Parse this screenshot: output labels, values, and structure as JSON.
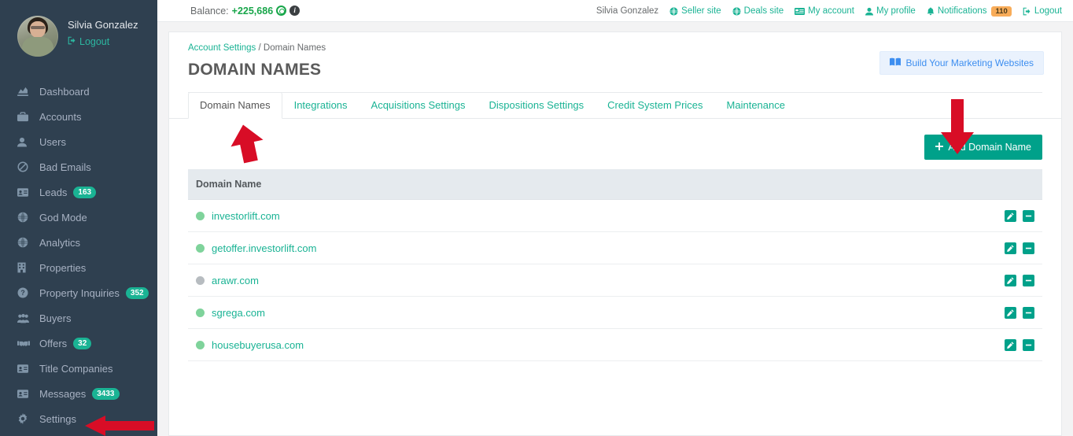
{
  "sidebar": {
    "profile": {
      "name": "Silvia Gonzalez",
      "logout_label": "Logout",
      "avatar_icon": "user-avatar-photo"
    },
    "items": [
      {
        "label": "Dashboard",
        "icon": "chart-area-icon",
        "badge": ""
      },
      {
        "label": "Accounts",
        "icon": "briefcase-icon",
        "badge": ""
      },
      {
        "label": "Users",
        "icon": "user-icon",
        "badge": ""
      },
      {
        "label": "Bad Emails",
        "icon": "ban-icon",
        "badge": ""
      },
      {
        "label": "Leads",
        "icon": "id-card-icon",
        "badge": "163"
      },
      {
        "label": "God Mode",
        "icon": "globe-icon",
        "badge": ""
      },
      {
        "label": "Analytics",
        "icon": "globe-icon",
        "badge": ""
      },
      {
        "label": "Properties",
        "icon": "building-icon",
        "badge": ""
      },
      {
        "label": "Property Inquiries",
        "icon": "question-icon",
        "badge": "352"
      },
      {
        "label": "Buyers",
        "icon": "users-icon",
        "badge": ""
      },
      {
        "label": "Offers",
        "icon": "handshake-icon",
        "badge": "32"
      },
      {
        "label": "Title Companies",
        "icon": "id-card-icon",
        "badge": ""
      },
      {
        "label": "Messages",
        "icon": "id-card-icon",
        "badge": "3433"
      },
      {
        "label": "Settings",
        "icon": "gear-icon",
        "badge": ""
      }
    ]
  },
  "topbar": {
    "balance_label": "Balance:",
    "balance_value": "+225,686",
    "coin_icon": "credit-coin-icon",
    "info_icon": "info-circle-icon",
    "user_name": "Silvia Gonzalez",
    "links": [
      {
        "label": "Seller site",
        "icon": "globe-icon"
      },
      {
        "label": "Deals site",
        "icon": "globe-icon"
      },
      {
        "label": "My account",
        "icon": "card-icon"
      },
      {
        "label": "My profile",
        "icon": "user-icon"
      },
      {
        "label": "Notifications",
        "icon": "bell-icon",
        "badge": "110"
      },
      {
        "label": "Logout",
        "icon": "logout-icon"
      }
    ]
  },
  "breadcrumb": {
    "parent": "Account Settings",
    "separator": "/",
    "current": "Domain Names"
  },
  "page": {
    "title": "DOMAIN NAMES",
    "build_button": "Build Your Marketing Websites",
    "build_icon": "book-icon"
  },
  "tabs": [
    {
      "label": "Domain Names",
      "active": true
    },
    {
      "label": "Integrations",
      "active": false
    },
    {
      "label": "Acquisitions Settings",
      "active": false
    },
    {
      "label": "Dispositions Settings",
      "active": false
    },
    {
      "label": "Credit System Prices",
      "active": false
    },
    {
      "label": "Maintenance",
      "active": false
    }
  ],
  "toolbar": {
    "add_label": "Add Domain Name",
    "add_icon": "plus-icon"
  },
  "table": {
    "columns": [
      "Domain Name"
    ],
    "rows": [
      {
        "domain": "investorlift.com",
        "status": "active",
        "edit_icon": "pencil-icon",
        "remove_icon": "minus-icon"
      },
      {
        "domain": "getoffer.investorlift.com",
        "status": "active",
        "edit_icon": "pencil-icon",
        "remove_icon": "minus-icon"
      },
      {
        "domain": "arawr.com",
        "status": "inactive",
        "edit_icon": "pencil-icon",
        "remove_icon": "minus-icon"
      },
      {
        "domain": "sgrega.com",
        "status": "active",
        "edit_icon": "pencil-icon",
        "remove_icon": "minus-icon"
      },
      {
        "domain": "housebuyerusa.com",
        "status": "active",
        "edit_icon": "pencil-icon",
        "remove_icon": "minus-icon"
      }
    ]
  },
  "annotations": [
    {
      "name": "arrow-pointing-to-domain-names-tab",
      "direction": "up",
      "color": "#d80d26"
    },
    {
      "name": "arrow-pointing-to-add-domain-name",
      "direction": "down",
      "color": "#d80d26"
    },
    {
      "name": "arrow-pointing-to-settings",
      "direction": "left",
      "color": "#d80d26"
    }
  ],
  "colors": {
    "sidebar_bg": "#2f4050",
    "accent_teal": "#1ab394",
    "button_teal": "#00a18a",
    "badge_warn": "#f8ac59",
    "annotation_red": "#d80d26",
    "status_active": "#7fd39b",
    "status_inactive": "#b7bcc0"
  }
}
